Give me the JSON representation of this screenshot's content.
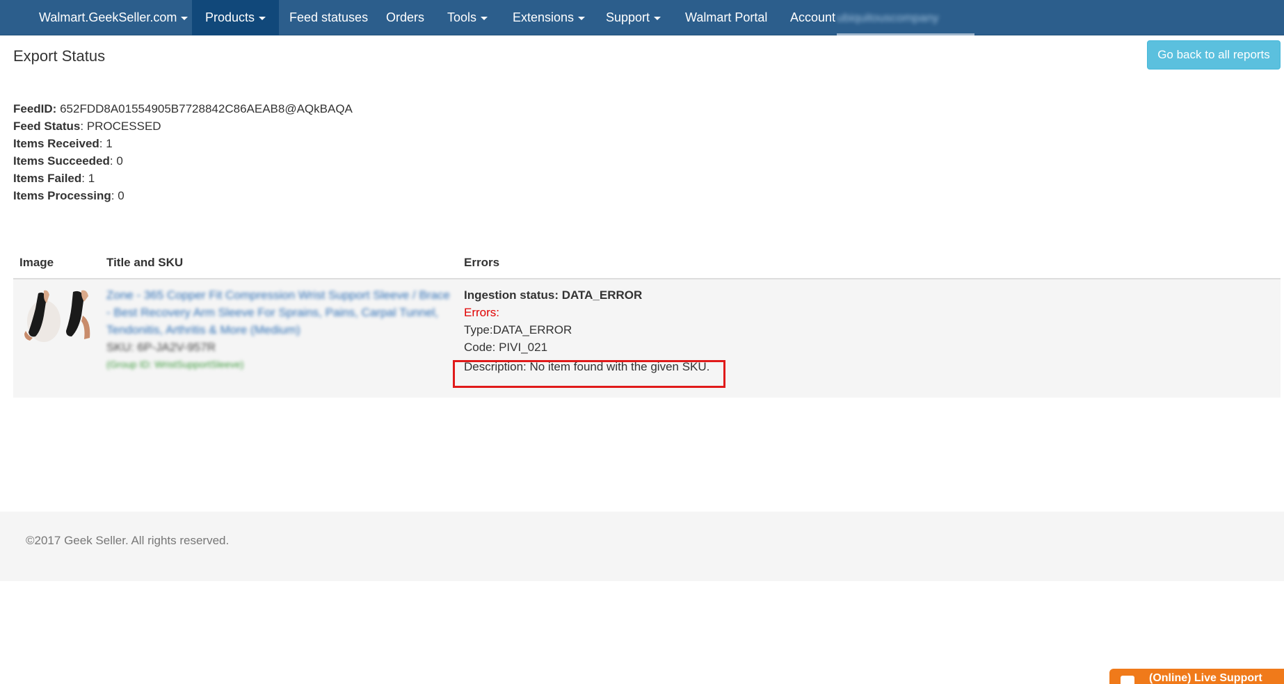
{
  "navbar": {
    "brand": "Walmart.GeekSeller.com",
    "items": [
      {
        "label": "Products",
        "dropdown": true,
        "active": true
      },
      {
        "label": "Feed statuses"
      },
      {
        "label": "Orders"
      },
      {
        "label": "Tools",
        "dropdown": true
      },
      {
        "label": "Extensions",
        "dropdown": true
      },
      {
        "label": "Support",
        "dropdown": true
      },
      {
        "label": "Walmart Portal"
      },
      {
        "label": "Account",
        "dropdown": true
      }
    ],
    "account_name_blurred": "ubiquitouscompany"
  },
  "page": {
    "title": "Export Status",
    "back_button": "Go back to all reports"
  },
  "feed": {
    "feed_id_label": "FeedID:",
    "feed_id": "652FDD8A01554905B7728842C86AEAB8@AQkBAQA",
    "status_label": "Feed Status",
    "status": "PROCESSED",
    "received_label": "Items Received",
    "received": "1",
    "succeeded_label": "Items Succeeded",
    "succeeded": "0",
    "failed_label": "Items Failed",
    "failed": "1",
    "processing_label": "Items Processing",
    "processing": "0"
  },
  "table": {
    "headers": [
      "Image",
      "Title and SKU",
      "Errors"
    ],
    "rows": [
      {
        "title": "Zone - 365 Copper Fit Compression Wrist Support Sleeve / Brace - Best Recovery Arm Sleeve For Sprains, Pains, Carpal Tunnel, Tendonitis, Arthritis & More (Medium)",
        "sku": "SKU: 6P-JA2V-957R",
        "group": "(Group ID: WristSupportSleeve)",
        "ingestion_status": "Ingestion status: DATA_ERROR",
        "errors_label": "Errors:",
        "type": "Type:DATA_ERROR",
        "code": "Code: PIVI_021",
        "description": "Description: No item found with the given SKU."
      }
    ]
  },
  "footer": {
    "copyright": "©2017 Geek Seller. All rights reserved."
  },
  "live_support": {
    "label": "(Online) Live Support"
  },
  "colors": {
    "navbar": "#2c5e8c",
    "navbar_active": "#11487a",
    "button_info": "#5bc0de",
    "error_red": "#e00000",
    "live_support": "#f07a1a"
  }
}
